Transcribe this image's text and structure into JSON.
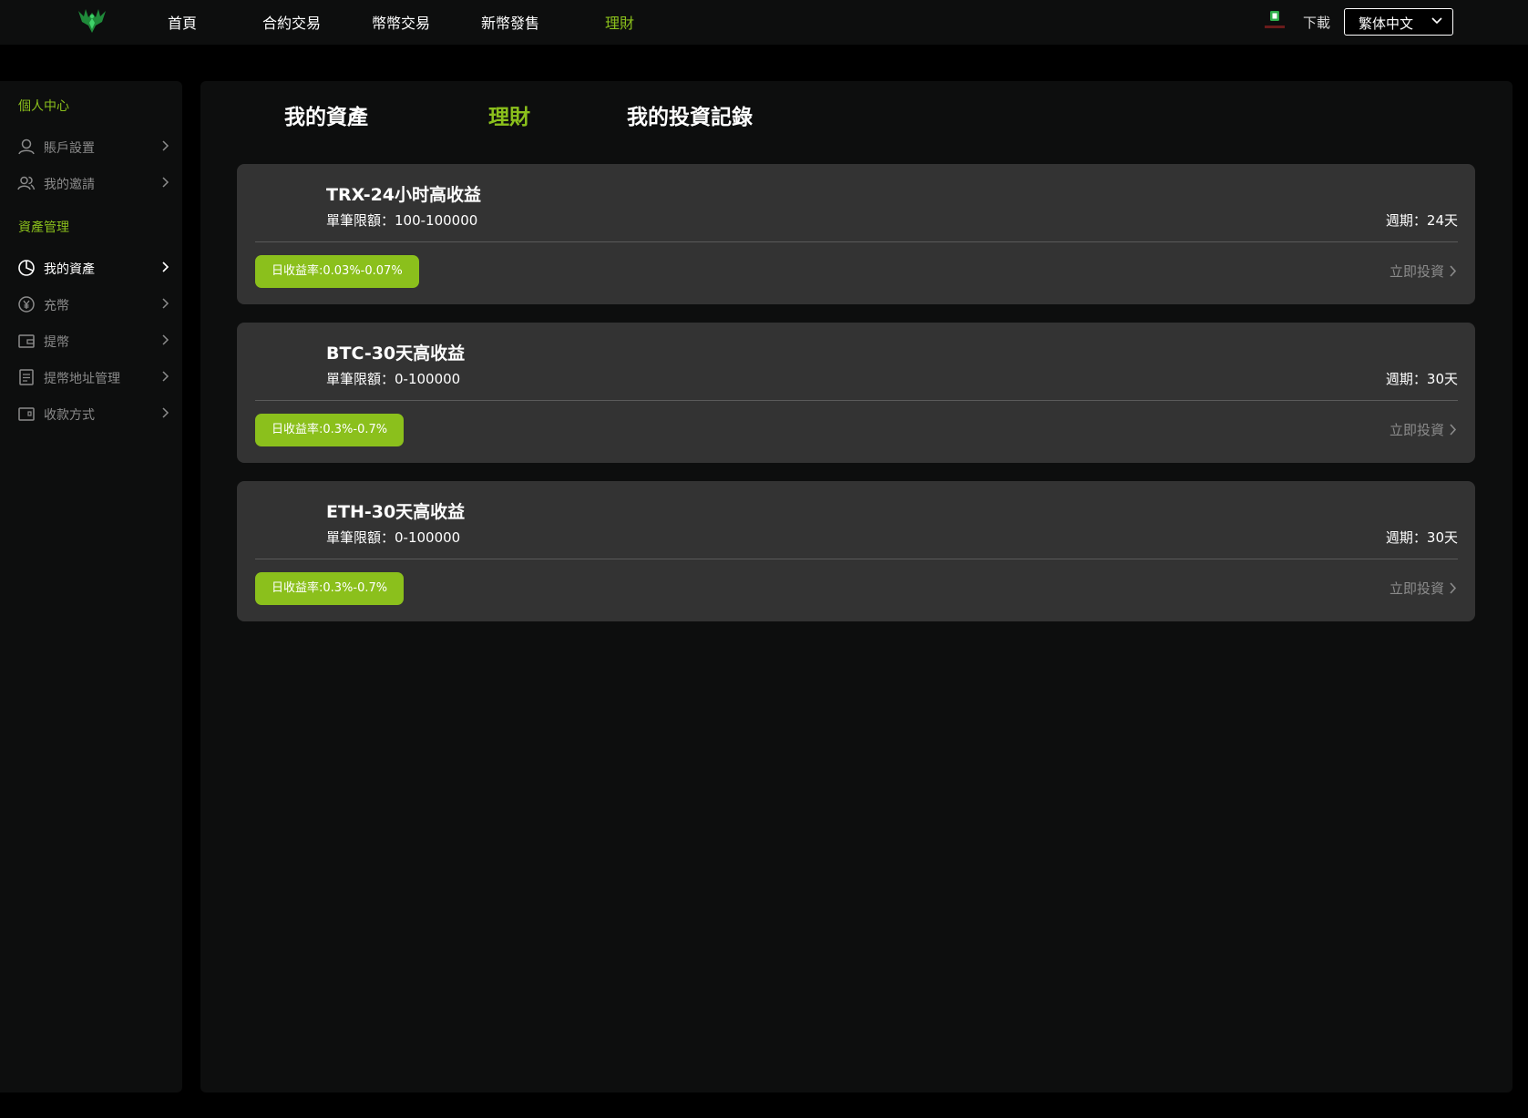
{
  "header": {
    "nav": [
      {
        "label": "首頁",
        "active": false
      },
      {
        "label": "合約交易",
        "active": false
      },
      {
        "label": "幣幣交易",
        "active": false
      },
      {
        "label": "新幣發售",
        "active": false
      },
      {
        "label": "理財",
        "active": true
      }
    ],
    "download_label": "下載",
    "language": "繁体中文",
    "icons": {
      "logo": "phoenix-logo-icon",
      "app": "app-download-icon",
      "chevron": "chevron-down-icon"
    }
  },
  "sidebar": {
    "section1": "個人中心",
    "section2": "資產管理",
    "items": [
      {
        "label": "賬戶設置",
        "icon": "user-icon",
        "active": false
      },
      {
        "label": "我的邀請",
        "icon": "users-icon",
        "active": false
      },
      {
        "label": "我的資產",
        "icon": "pie-chart-icon",
        "active": true
      },
      {
        "label": "充幣",
        "icon": "yen-coin-icon",
        "active": false
      },
      {
        "label": "提幣",
        "icon": "wallet-icon",
        "active": false
      },
      {
        "label": "提幣地址管理",
        "icon": "address-book-icon",
        "active": false
      },
      {
        "label": "收款方式",
        "icon": "card-icon",
        "active": false
      }
    ]
  },
  "main": {
    "tabs": [
      {
        "label": "我的資產",
        "active": false
      },
      {
        "label": "理財",
        "active": true
      },
      {
        "label": "我的投資記錄",
        "active": false
      }
    ],
    "products": [
      {
        "title": "TRX-24小时高收益",
        "limit": "單筆限額：100-100000",
        "period": "週期：24天",
        "rate": "日收益率:0.03%-0.07%",
        "action": "立即投資"
      },
      {
        "title": "BTC-30天高收益",
        "limit": "單筆限額：0-100000",
        "period": "週期：30天",
        "rate": "日收益率:0.3%-0.7%",
        "action": "立即投資"
      },
      {
        "title": "ETH-30天高收益",
        "limit": "單筆限額：0-100000",
        "period": "週期：30天",
        "rate": "日收益率:0.3%-0.7%",
        "action": "立即投資"
      }
    ]
  },
  "colors": {
    "accent": "#8bc01c",
    "card": "#333333",
    "panel": "#0d0e0e",
    "muted": "#8b8b8b"
  }
}
